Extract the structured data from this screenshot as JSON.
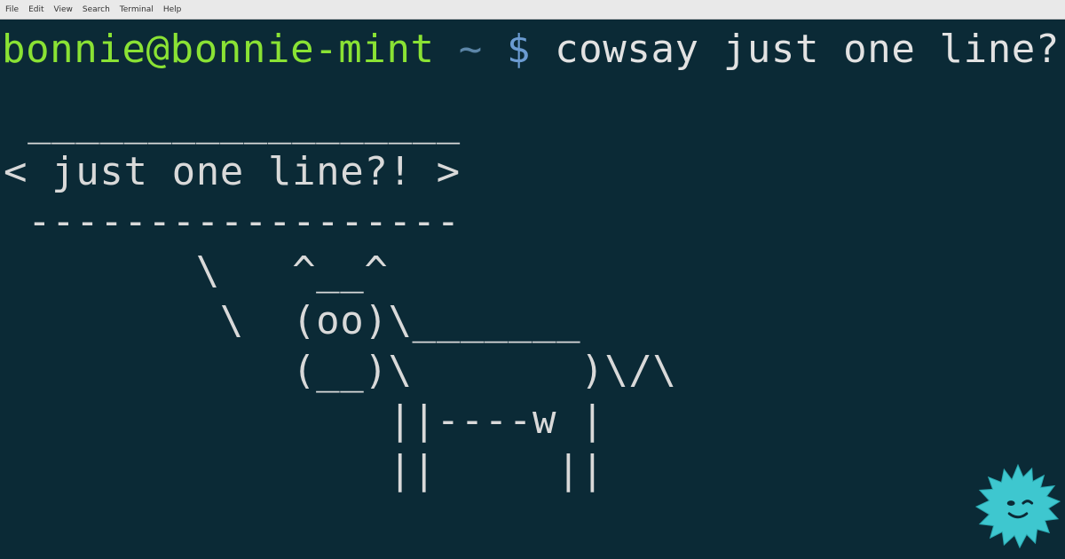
{
  "menu": {
    "items": [
      {
        "label": "File"
      },
      {
        "label": "Edit"
      },
      {
        "label": "View"
      },
      {
        "label": "Search"
      },
      {
        "label": "Terminal"
      },
      {
        "label": "Help"
      }
    ]
  },
  "terminal": {
    "prompt": {
      "user_host": "bonnie@bonnie-mint",
      "path": "~",
      "symbol": "$",
      "command": "cowsay just one line?!"
    },
    "output_lines": [
      " __________________",
      "< just one line?! >",
      " ------------------",
      "        \\   ^__^",
      "         \\  (oo)\\_______",
      "            (__)\\       )\\/\\",
      "                ||----w |",
      "                ||     ||"
    ]
  },
  "colors": {
    "background": "#0b2a36",
    "user_host": "#8ae234",
    "path": "#5c86a8",
    "symbol": "#6b9bd1",
    "text": "#d9d9d9",
    "mascot": "#3ec7cf"
  },
  "icons": {
    "mascot": "spiky-cyan-mascot-icon"
  }
}
